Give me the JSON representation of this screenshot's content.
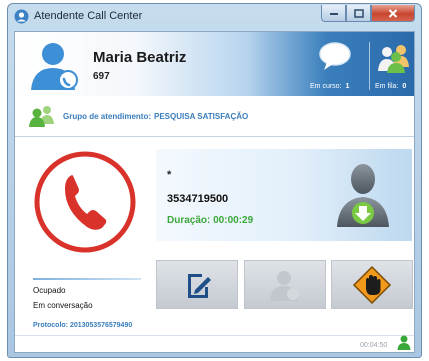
{
  "window": {
    "title": "Atendente Call Center"
  },
  "agent": {
    "name": "Maria Beatriz",
    "extension": "697"
  },
  "queue": {
    "in_progress_label": "Em curso:",
    "in_progress_count": "1",
    "waiting_label": "Em fila:",
    "waiting_count": "0"
  },
  "group": {
    "label": "Grupo de atendimento:",
    "value": "PESQUISA SATISFAÇÃO"
  },
  "call": {
    "caller_name": "*",
    "caller_number": "3534719500",
    "duration_label": "Duração:",
    "duration_value": "00:00:29",
    "duration_text": "Duração: 00:00:29"
  },
  "status": {
    "line1": "Ocupado",
    "line2": "Em conversação",
    "protocol_text": "Protocolo: 2013053576579490"
  },
  "footer": {
    "time": "00:04:50"
  },
  "icons": {
    "app": "headset-app-icon",
    "agent_avatar": "agent-avatar-icon",
    "chat": "chat-bubble-icon",
    "people": "people-group-icon",
    "group": "group-icon",
    "status": "phone-busy-icon",
    "caller": "caller-transfer-icon",
    "notes": "edit-notes-icon",
    "transfer": "transfer-disabled-icon",
    "hangup": "stop-hand-icon",
    "footer": "user-online-icon"
  },
  "colors": {
    "accent_blue": "#3a7dbb",
    "busy_red": "#d9322a",
    "duration_green": "#3aa73a",
    "warning_orange": "#f19a1b"
  }
}
